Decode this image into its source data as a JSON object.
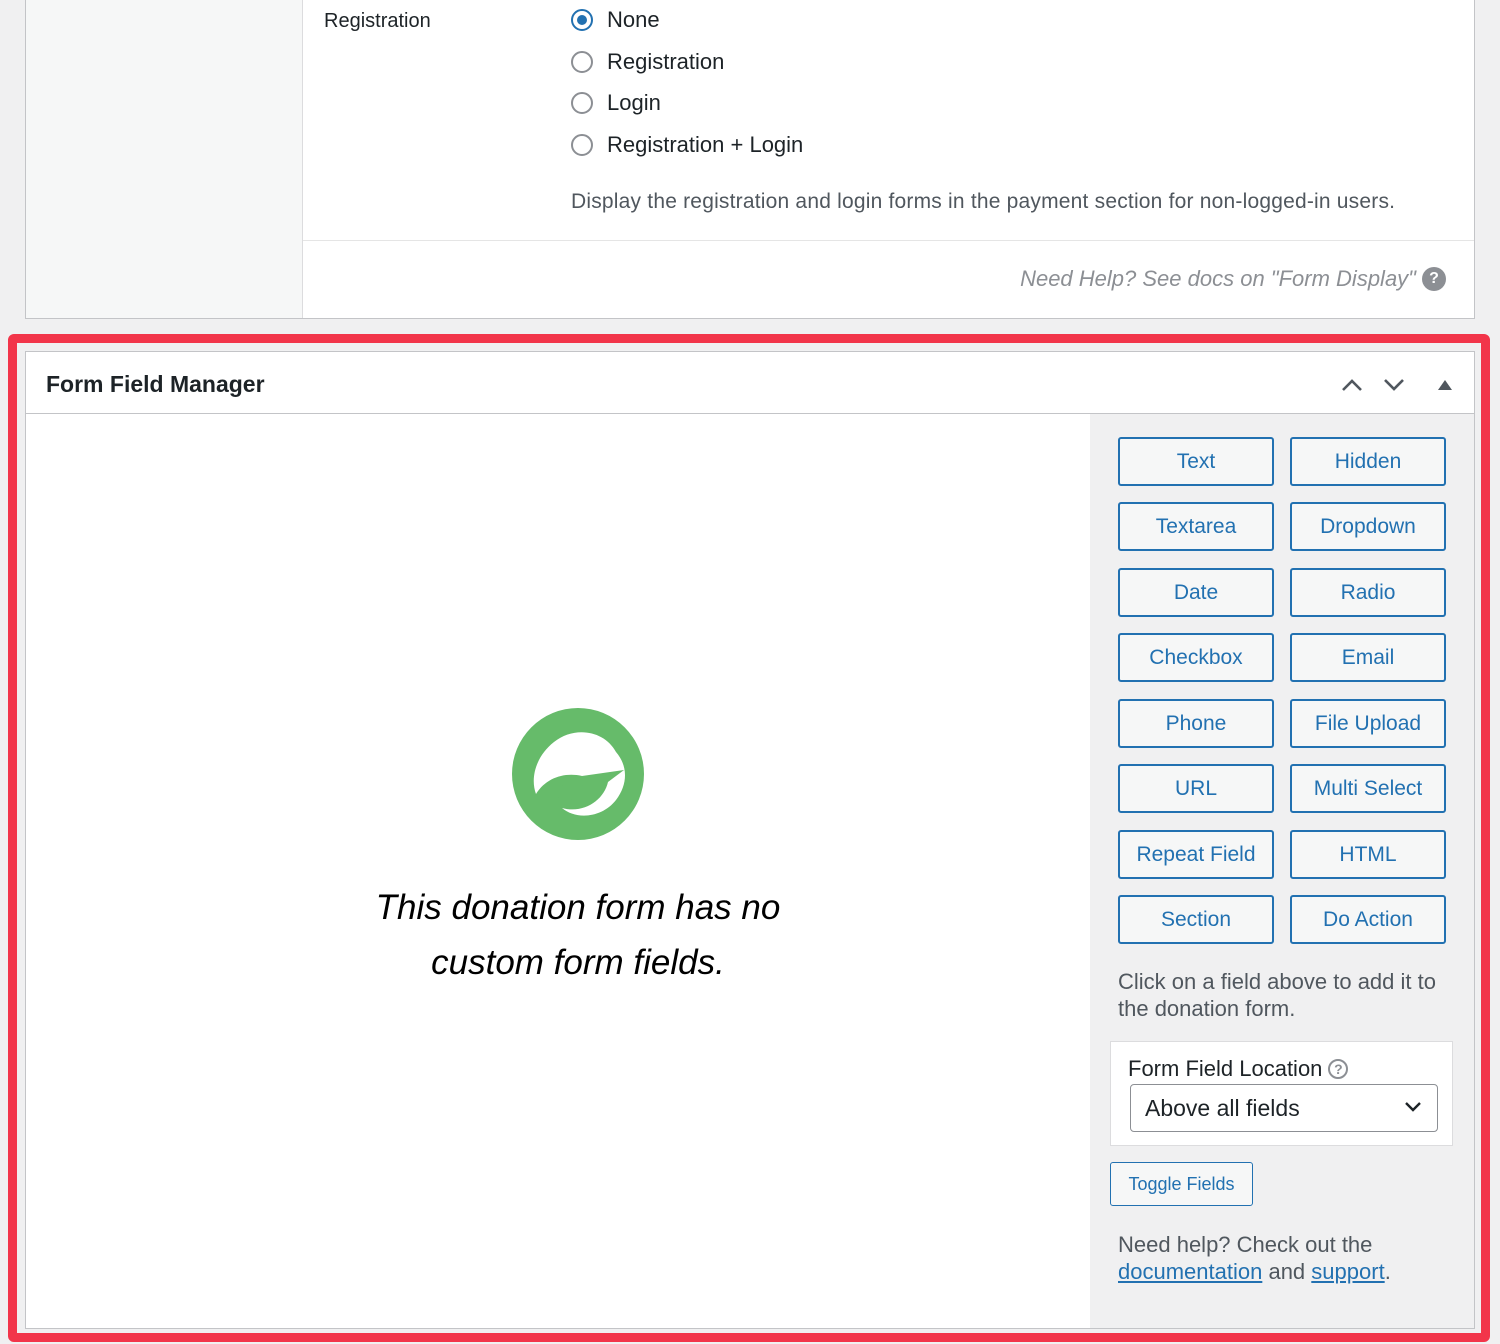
{
  "registration": {
    "label": "Registration",
    "options": [
      {
        "label": "None",
        "checked": true
      },
      {
        "label": "Registration",
        "checked": false
      },
      {
        "label": "Login",
        "checked": false
      },
      {
        "label": "Registration + Login",
        "checked": false
      }
    ],
    "description": "Display the registration and login forms in the payment section for non-logged-in users.",
    "help_text": "Need Help? See docs on \"Form Display\""
  },
  "ffm": {
    "title": "Form Field Manager",
    "empty_message_line1": "This donation form has no",
    "empty_message_line2": "custom form fields.",
    "field_buttons": [
      "Text",
      "Hidden",
      "Textarea",
      "Dropdown",
      "Date",
      "Radio",
      "Checkbox",
      "Email",
      "Phone",
      "File Upload",
      "URL",
      "Multi Select",
      "Repeat Field",
      "HTML",
      "Section",
      "Do Action"
    ],
    "hint": "Click on a field above to add it to the donation form.",
    "location_label": "Form Field Location",
    "location_value": "Above all fields",
    "toggle_label": "Toggle Fields",
    "help_prefix": "Need help? Check out the",
    "help_link1": "documentation",
    "help_and": "and",
    "help_link2": "support",
    "help_suffix": "."
  },
  "colors": {
    "accent": "#2271b1",
    "highlight": "#f2354a",
    "logo_green": "#66bb6a"
  }
}
